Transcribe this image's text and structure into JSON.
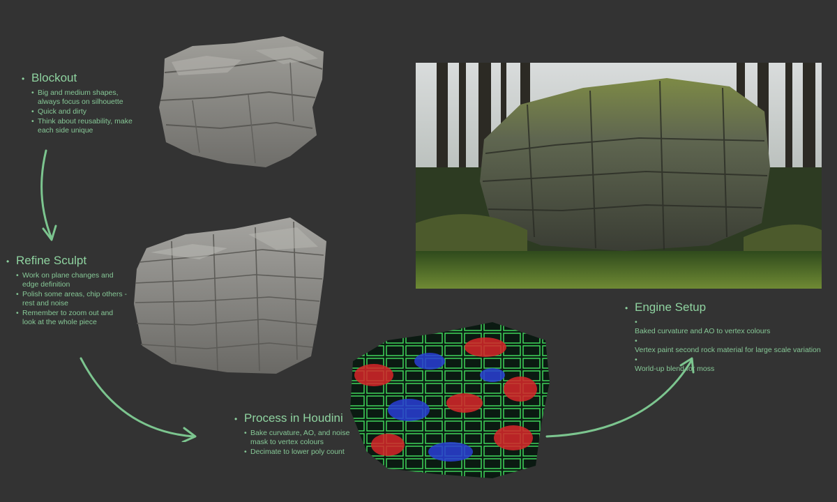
{
  "steps": {
    "blockout": {
      "title": "Blockout",
      "bullets": [
        "Big and medium shapes, always focus on silhouette",
        "Quick and dirty",
        "Think about reusability, make each side unique"
      ]
    },
    "refine": {
      "title": "Refine Sculpt",
      "bullets": [
        "Work on plane changes and edge definition",
        "Polish some areas, chip others - rest and noise",
        "Remember to zoom out and look at the whole piece"
      ]
    },
    "houdini": {
      "title": "Process in Houdini",
      "bullets": [
        "Bake curvature, AO, and noise mask to vertex colours",
        "Decimate to lower poly count"
      ]
    },
    "engine": {
      "title": "Engine Setup",
      "bullets": [
        "Baked curvature and AO to vertex colours",
        "Vertex paint second rock material for large scale variation",
        "World-up blend for moss"
      ]
    }
  },
  "colors": {
    "background": "#333333",
    "accent": "#8fd3a0",
    "arrow": "#7cc58f",
    "sculpt_gray": "#8c8b87"
  },
  "icons": {
    "bullet": "•"
  }
}
